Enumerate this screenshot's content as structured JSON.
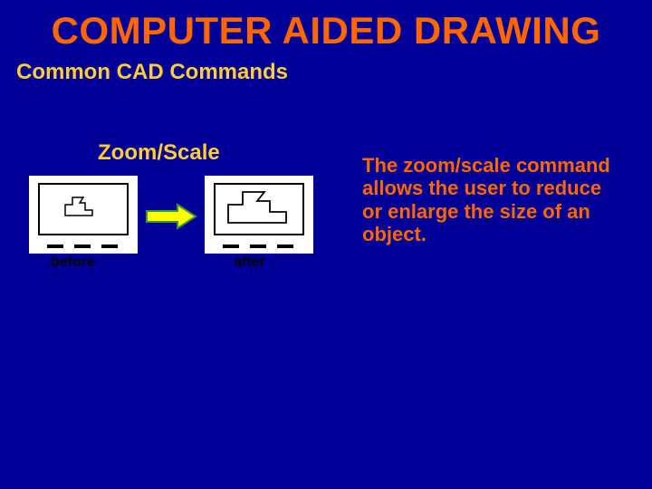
{
  "title": "COMPUTER AIDED DRAWING",
  "subtitle": "Common CAD Commands",
  "section": "Zoom/Scale",
  "labels": {
    "before": "before",
    "after": "after"
  },
  "description": "The zoom/scale command allows the user to reduce or enlarge the size of an object.",
  "colors": {
    "background": "#000099",
    "title": "#ff6600",
    "accent": "#ffcc33",
    "arrow_fill": "#ffff00",
    "arrow_stroke": "#339933"
  }
}
